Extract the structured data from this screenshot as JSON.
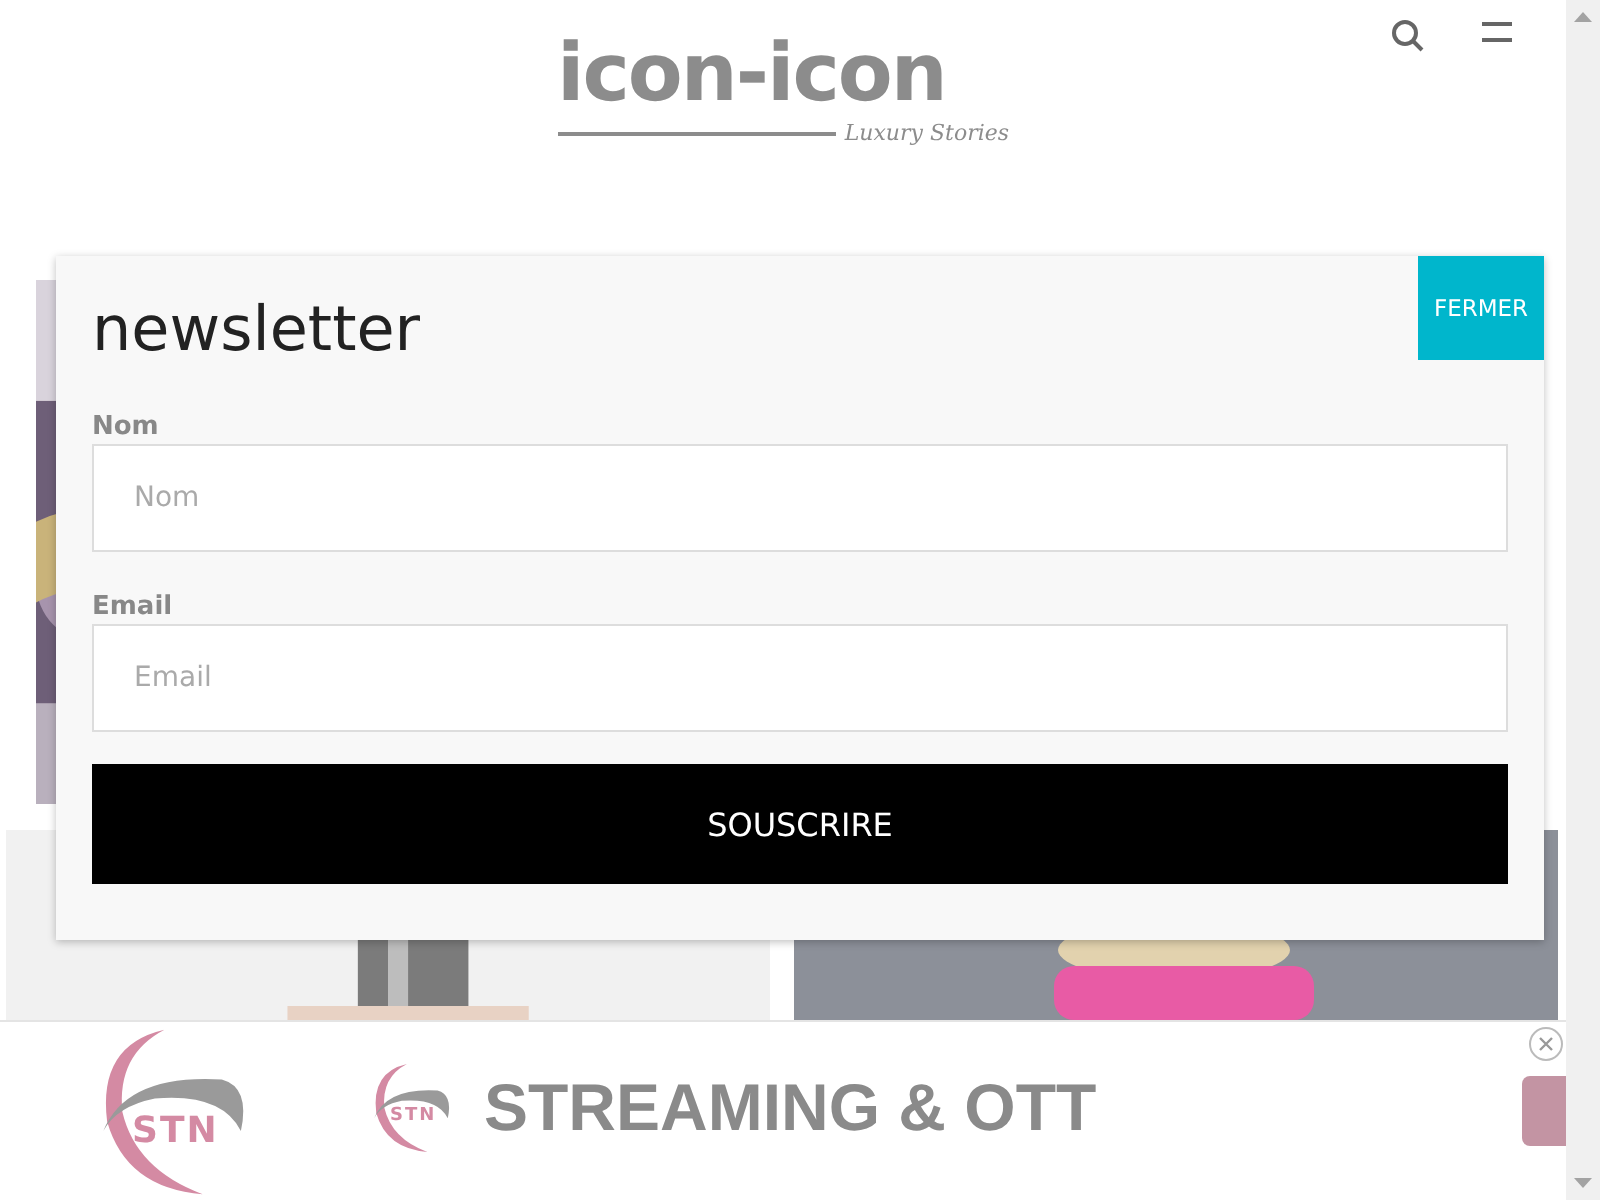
{
  "header": {
    "logo": "icon-icon",
    "tagline": "Luxury Stories"
  },
  "newsletter": {
    "title": "newsletter",
    "close": "FERMER",
    "fields": [
      {
        "label": "Nom",
        "placeholder": "Nom"
      },
      {
        "label": "Email",
        "placeholder": "Email"
      }
    ],
    "submit": "SOUSCRIRE"
  },
  "ad": {
    "logo": "STN",
    "small_logo": "STN",
    "headline": "STREAMING & OTT"
  }
}
